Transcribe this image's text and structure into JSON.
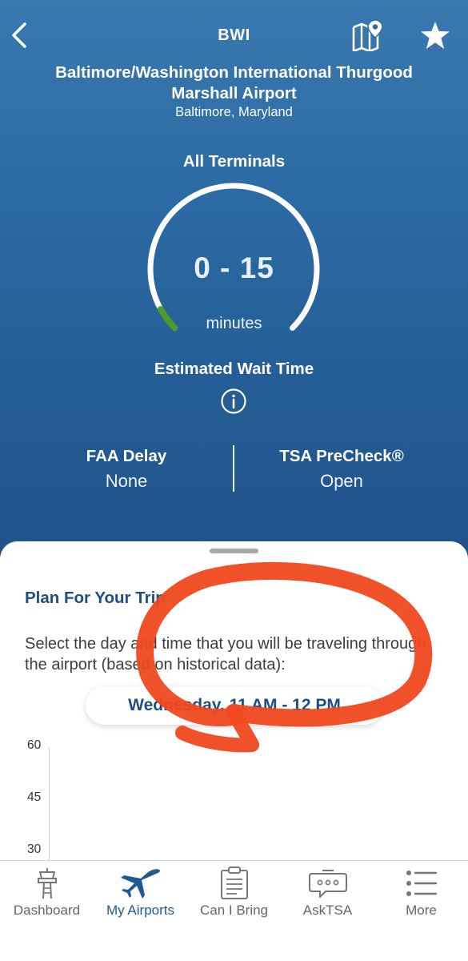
{
  "header": {
    "code": "BWI",
    "back_icon": "chevron-left-icon",
    "map_icon": "map-pin-icon",
    "favorite_icon": "star-icon"
  },
  "airport": {
    "name": "Baltimore/Washington International Thurgood Marshall Airport",
    "city": "Baltimore, Maryland"
  },
  "wait": {
    "terminal": "All Terminals",
    "range": "0 - 15",
    "unit": "minutes",
    "label": "Estimated Wait Time",
    "info_icon": "info-icon",
    "gauge_level_fraction": 0.06,
    "gauge_color": "#4e9a2e",
    "track_color": "#ffffff"
  },
  "status": {
    "faa_label": "FAA Delay",
    "faa_value": "None",
    "precheck_label": "TSA PreCheck®",
    "precheck_value": "Open"
  },
  "plan": {
    "title": "Plan For Your Trip",
    "description": "Select the day and time that you will be traveling through the airport (based on historical data):",
    "selector": "Wednesday, 11 AM - 12 PM"
  },
  "chart_data": {
    "type": "bar",
    "yticks": [
      "60",
      "45",
      "30"
    ]
  },
  "colors": {
    "accent": "#1f4f82",
    "hero_top": "#3a78b0",
    "hero_bottom": "#1f5189",
    "annotation": "#f0481d"
  },
  "tabs": [
    {
      "label": "Dashboard",
      "icon": "control-tower-icon",
      "active": false
    },
    {
      "label": "My Airports",
      "icon": "airplane-icon",
      "active": true
    },
    {
      "label": "Can I Bring",
      "icon": "clipboard-icon",
      "active": false
    },
    {
      "label": "AskTSA",
      "icon": "chat-bubble-icon",
      "active": false
    },
    {
      "label": "More",
      "icon": "list-icon",
      "active": false
    }
  ]
}
